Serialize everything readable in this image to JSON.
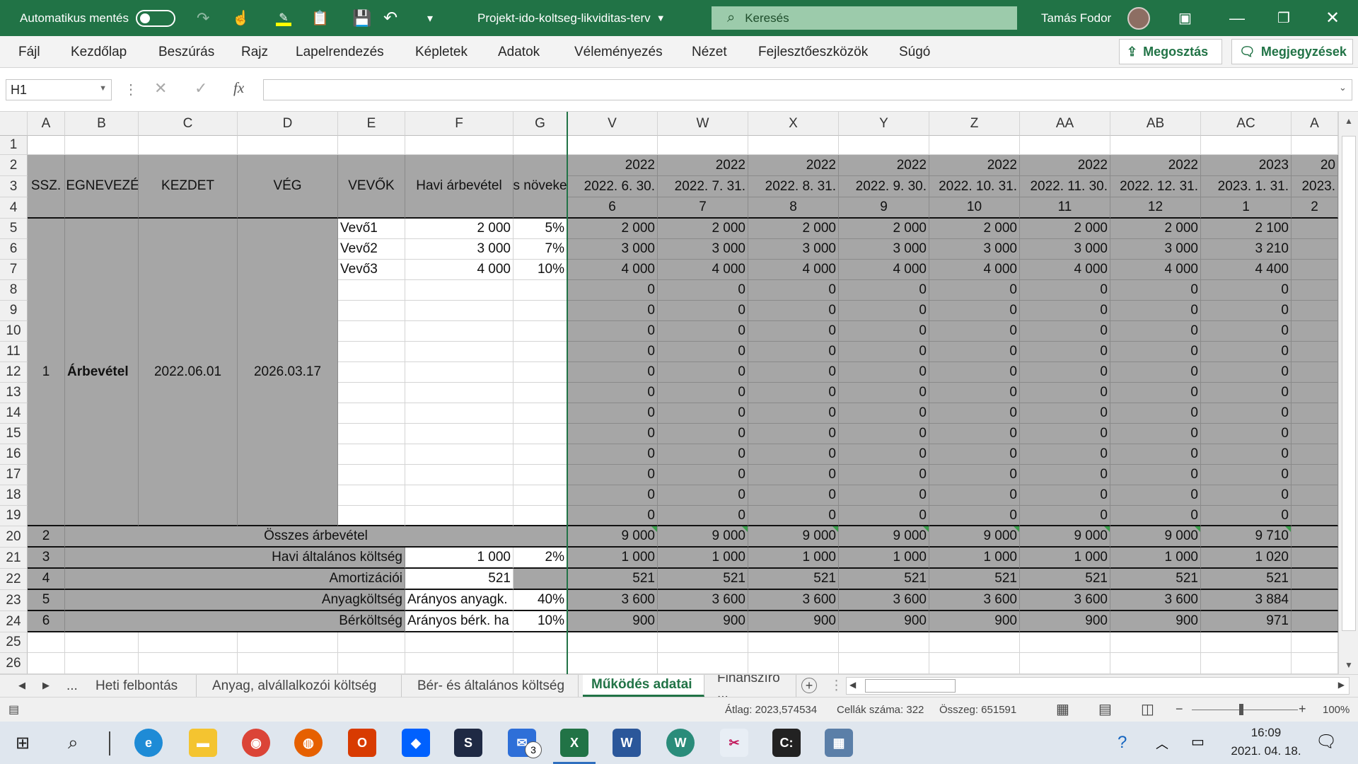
{
  "titlebar": {
    "autosave_label": "Automatikus mentés",
    "filename": "Projekt-ido-koltseg-likviditas-terv",
    "search_placeholder": "Keresés",
    "user_name": "Tamás Fodor"
  },
  "menu": {
    "items": [
      "Fájl",
      "Kezdőlap",
      "Beszúrás",
      "Rajz",
      "Lapelrendezés",
      "Képletek",
      "Adatok",
      "Véleményezés",
      "Nézet",
      "Fejlesztőeszközök",
      "Súgó"
    ],
    "share": "Megosztás",
    "comments": "Megjegyzések"
  },
  "formula_bar": {
    "name_box": "H1",
    "fx": "fx",
    "content": ""
  },
  "columns": [
    "A",
    "B",
    "C",
    "D",
    "E",
    "F",
    "G",
    "V",
    "W",
    "X",
    "Y",
    "Z",
    "AA",
    "AB",
    "AC",
    "A"
  ],
  "rows": [
    "1",
    "2",
    "3",
    "4",
    "5",
    "6",
    "7",
    "8",
    "9",
    "10",
    "11",
    "12",
    "13",
    "14",
    "15",
    "16",
    "17",
    "18",
    "19",
    "20",
    "21",
    "22",
    "23",
    "24",
    "25",
    "26"
  ],
  "headers": {
    "ssz": "SSZ.",
    "megnevezes": "MEGNEVEZÉS",
    "kezdet": "KEZDET",
    "veg": "VÉG",
    "vevok": "VEVŐK",
    "havi": "Havi árbevétel",
    "noveked": "s növeke"
  },
  "years": [
    "2022",
    "2022",
    "2022",
    "2022",
    "2022",
    "2022",
    "2022",
    "2023",
    "20"
  ],
  "dates": [
    "2022. 6. 30.",
    "2022. 7. 31.",
    "2022. 8. 31.",
    "2022. 9. 30.",
    "2022. 10. 31.",
    "2022. 11. 30.",
    "2022. 12. 31.",
    "2023. 1. 31.",
    "2023."
  ],
  "months": [
    "6",
    "7",
    "8",
    "9",
    "10",
    "11",
    "12",
    "1",
    "2"
  ],
  "block": {
    "ssz": "1",
    "name": "Árbevétel",
    "start": "2022.06.01",
    "end": "2026.03.17"
  },
  "customers": [
    {
      "name": "Vevő1",
      "amount": "2 000",
      "growth": "5%",
      "values": [
        "2 000",
        "2 000",
        "2 000",
        "2 000",
        "2 000",
        "2 000",
        "2 000",
        "2 100"
      ]
    },
    {
      "name": "Vevő2",
      "amount": "3 000",
      "growth": "7%",
      "values": [
        "3 000",
        "3 000",
        "3 000",
        "3 000",
        "3 000",
        "3 000",
        "3 000",
        "3 210"
      ]
    },
    {
      "name": "Vevő3",
      "amount": "4 000",
      "growth": "10%",
      "values": [
        "4 000",
        "4 000",
        "4 000",
        "4 000",
        "4 000",
        "4 000",
        "4 000",
        "4 400"
      ]
    }
  ],
  "zero": "0",
  "summary": [
    {
      "ssz": "2",
      "label": "Összes árbevétel",
      "f": "",
      "g": "",
      "values": [
        "9 000",
        "9 000",
        "9 000",
        "9 000",
        "9 000",
        "9 000",
        "9 000",
        "9 710"
      ]
    },
    {
      "ssz": "3",
      "label": "Havi általános költség",
      "f": "1 000",
      "g": "2%",
      "values": [
        "1 000",
        "1 000",
        "1 000",
        "1 000",
        "1 000",
        "1 000",
        "1 000",
        "1 020"
      ]
    },
    {
      "ssz": "4",
      "label": "Amortizációi",
      "f": "521",
      "g": "",
      "values": [
        "521",
        "521",
        "521",
        "521",
        "521",
        "521",
        "521",
        "521"
      ]
    },
    {
      "ssz": "5",
      "label": "Anyagköltség",
      "f": "Arányos anyagk.",
      "g": "40%",
      "values": [
        "3 600",
        "3 600",
        "3 600",
        "3 600",
        "3 600",
        "3 600",
        "3 600",
        "3 884"
      ]
    },
    {
      "ssz": "6",
      "label": "Bérköltség",
      "f": "Arányos bérk. ha",
      "g": "10%",
      "values": [
        "900",
        "900",
        "900",
        "900",
        "900",
        "900",
        "900",
        "971"
      ]
    }
  ],
  "sheets": [
    "...",
    "Heti felbontás",
    "Anyag, alvállalkozói költség",
    "Bér- és általános költség",
    "Működés adatai",
    "Finanszíro ..."
  ],
  "status": {
    "avg": "Átlag: 2023,574534",
    "count": "Cellák száma: 322",
    "sum": "Összeg: 651591",
    "zoom": "100%"
  },
  "taskbar": {
    "time": "16:09",
    "date": "2021. 04. 18.",
    "mail_badge": "3"
  }
}
